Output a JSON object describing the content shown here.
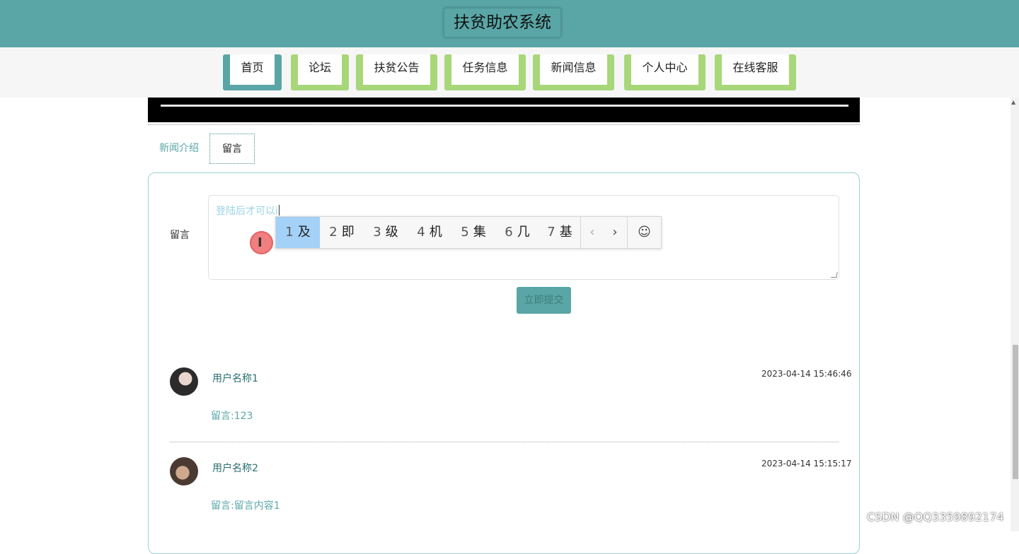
{
  "app": {
    "title": "扶贫助农系统"
  },
  "nav": {
    "items": [
      {
        "label": "首页",
        "active": true
      },
      {
        "label": "论坛",
        "active": false
      },
      {
        "label": "扶贫公告",
        "active": false
      },
      {
        "label": "任务信息",
        "active": false
      },
      {
        "label": "新闻信息",
        "active": false
      },
      {
        "label": "个人中心",
        "active": false
      },
      {
        "label": "在线客服",
        "active": false
      }
    ]
  },
  "tabs": {
    "intro_label": "新闻介绍",
    "message_label": "留言"
  },
  "form": {
    "label": "留言",
    "placeholder": "登陆后才可以i",
    "submit_label": "立即提交"
  },
  "ime": {
    "candidates": [
      {
        "num": "1",
        "text": "及"
      },
      {
        "num": "2",
        "text": "即"
      },
      {
        "num": "3",
        "text": "级"
      },
      {
        "num": "4",
        "text": "机"
      },
      {
        "num": "5",
        "text": "集"
      },
      {
        "num": "6",
        "text": "几"
      },
      {
        "num": "7",
        "text": "基"
      }
    ],
    "prev_icon": "‹",
    "next_icon": "›",
    "emoji_icon": "☺"
  },
  "comments": [
    {
      "user": "用户名称1",
      "time": "2023-04-14 15:46:46",
      "text": "留言:123"
    },
    {
      "user": "用户名称2",
      "time": "2023-04-14 15:15:17",
      "text": "留言:留言内容1"
    }
  ],
  "watermark": "CSDN @QQ3359892174",
  "colors": {
    "primary": "#5aa6a6",
    "nav_tab": "#a8d77a",
    "ime_highlight": "#a3d1f7"
  }
}
